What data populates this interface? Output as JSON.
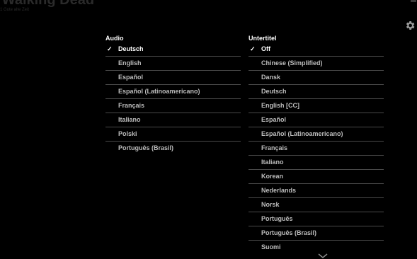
{
  "background": {
    "title": "e Walking Dead",
    "subtitle": "1 Gute alte Zeit"
  },
  "audio": {
    "header": "Audio",
    "items": [
      {
        "label": "Deutsch",
        "selected": true
      },
      {
        "label": "English",
        "selected": false
      },
      {
        "label": "Español",
        "selected": false
      },
      {
        "label": "Español (Latinoamericano)",
        "selected": false
      },
      {
        "label": "Français",
        "selected": false
      },
      {
        "label": "Italiano",
        "selected": false
      },
      {
        "label": "Polski",
        "selected": false
      },
      {
        "label": "Português (Brasil)",
        "selected": false
      }
    ]
  },
  "subtitles": {
    "header": "Untertitel",
    "items": [
      {
        "label": "Off",
        "selected": true
      },
      {
        "label": "Chinese (Simplified)",
        "selected": false
      },
      {
        "label": "Dansk",
        "selected": false
      },
      {
        "label": "Deutsch",
        "selected": false
      },
      {
        "label": "English [CC]",
        "selected": false
      },
      {
        "label": "Español",
        "selected": false
      },
      {
        "label": "Español (Latinoamericano)",
        "selected": false
      },
      {
        "label": "Français",
        "selected": false
      },
      {
        "label": "Italiano",
        "selected": false
      },
      {
        "label": "Korean",
        "selected": false
      },
      {
        "label": "Nederlands",
        "selected": false
      },
      {
        "label": "Norsk",
        "selected": false
      },
      {
        "label": "Português",
        "selected": false
      },
      {
        "label": "Português (Brasil)",
        "selected": false
      },
      {
        "label": "Suomi",
        "selected": false
      }
    ]
  },
  "checkmark": "✓",
  "icons": {
    "settings": "gear-icon",
    "scroll_more": "chevron-down-icon"
  },
  "colors": {
    "background": "#000000",
    "text_selected": "#ffffff",
    "text_unselected": "#bdbdbd",
    "divider": "#4a4a4a"
  }
}
